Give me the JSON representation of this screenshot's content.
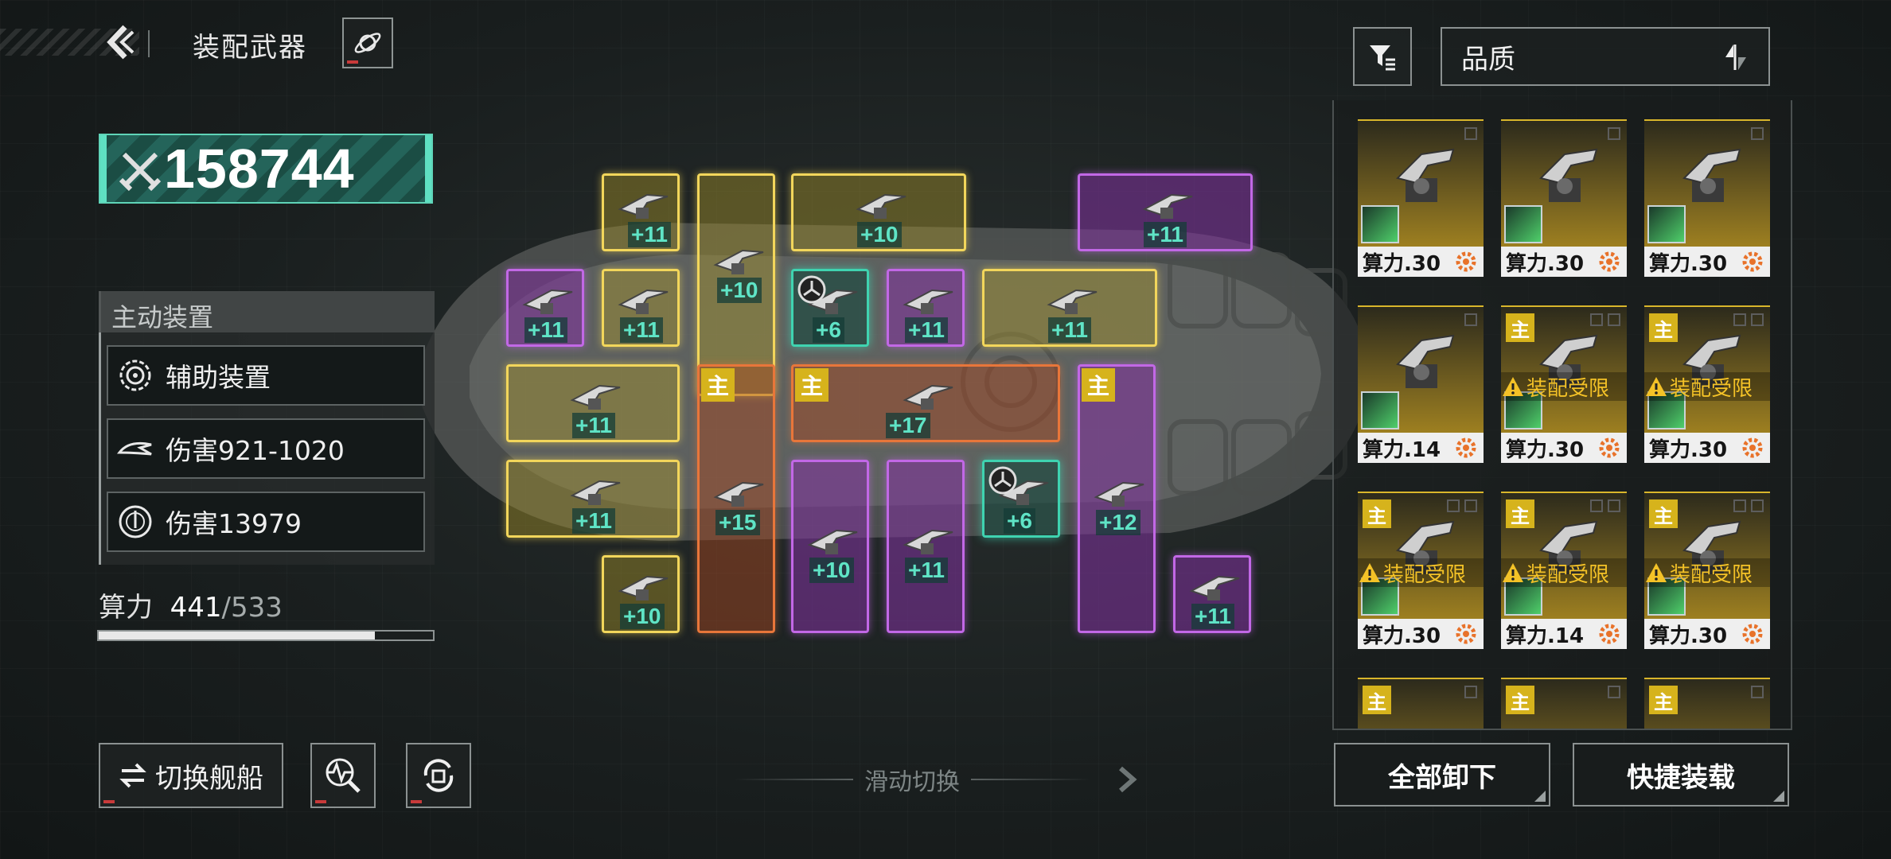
{
  "header": {
    "title": "装配武器"
  },
  "power": {
    "value": "158744"
  },
  "panel": {
    "title": "主动装置",
    "rows": [
      {
        "icon": "target-icon",
        "label": "辅助装置"
      },
      {
        "icon": "missile-icon",
        "label": "伤害921-1020"
      },
      {
        "icon": "crosshair-icon",
        "label": "伤害13979"
      }
    ]
  },
  "calc": {
    "label": "算力",
    "used": "441",
    "separator": "/",
    "max": "533",
    "fill_fraction": 0.827
  },
  "buttons": {
    "switch_ship": "切换舰船",
    "unload_all": "全部卸下",
    "quick_equip": "快捷装载"
  },
  "slide": {
    "label": "滑动切换"
  },
  "sort": {
    "label": "品质"
  },
  "slots": {
    "levels": [
      "+11",
      "+11",
      "+10",
      "+11",
      "+11",
      "+11",
      "+11",
      "+6",
      "+11",
      "+11",
      "+11",
      "+17",
      "+11",
      "+15",
      "+10",
      "+11",
      "+6",
      "+12",
      "+10",
      "+11"
    ],
    "main_badge": "主"
  },
  "inventory": [
    {
      "cost": "算力.30",
      "main": false,
      "restricted": false
    },
    {
      "cost": "算力.30",
      "main": false,
      "restricted": false
    },
    {
      "cost": "算力.30",
      "main": false,
      "restricted": false
    },
    {
      "cost": "算力.14",
      "main": false,
      "restricted": false
    },
    {
      "cost": "算力.30",
      "main": true,
      "restricted": true
    },
    {
      "cost": "算力.30",
      "main": true,
      "restricted": true
    },
    {
      "cost": "算力.30",
      "main": true,
      "restricted": true
    },
    {
      "cost": "算力.14",
      "main": true,
      "restricted": true
    },
    {
      "cost": "算力.30",
      "main": true,
      "restricted": true
    }
  ],
  "inventory_text": {
    "restricted": "装配受限",
    "main_badge": "主"
  },
  "colors": {
    "accent_teal": "#5fe4c6",
    "slot_yellow": "#f2d65b",
    "slot_purple": "#c268e6",
    "slot_orange": "#e8763a",
    "card_gold": "#b8931f",
    "warning": "#f4c227"
  }
}
